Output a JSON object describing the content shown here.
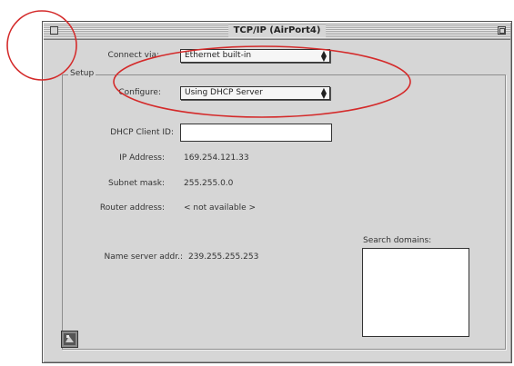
{
  "window": {
    "title": "TCP/IP (AirPort4)"
  },
  "connect": {
    "label": "Connect via:",
    "value": "Ethernet built-in"
  },
  "setup": {
    "group_label": "Setup"
  },
  "configure": {
    "label": "Configure:",
    "value": "Using DHCP Server"
  },
  "fields": {
    "dhcp_client_id_label": "DHCP Client ID:",
    "dhcp_client_id_value": "",
    "ip_label": "IP Address:",
    "ip_value": "169.254.121.33",
    "subnet_label": "Subnet mask:",
    "subnet_value": "255.255.0.0",
    "router_label": "Router address:",
    "router_value": "< not available >",
    "name_server_label": "Name server addr.:",
    "name_server_value": "239.255.255.253",
    "search_domains_label": "Search domains:"
  },
  "annotation_color": "#d42a2a"
}
